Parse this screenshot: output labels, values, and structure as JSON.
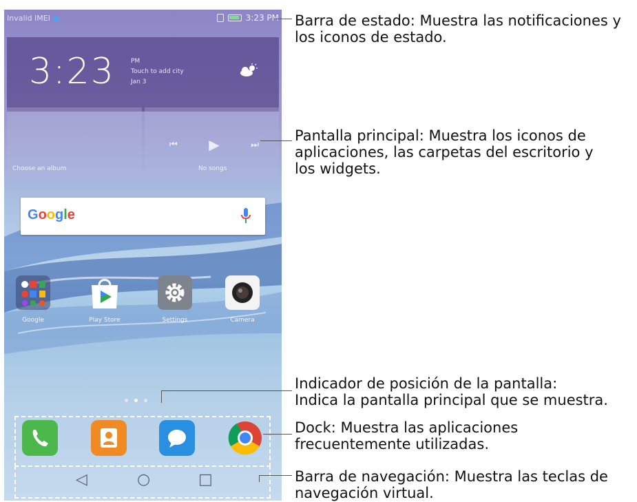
{
  "status_bar": {
    "left_text": "Invalid IMEI",
    "time": "3:23 PM"
  },
  "clock_widget": {
    "time": "3:23",
    "ampm": "PM",
    "city_prompt": "Touch to add city",
    "date": "Jan 3",
    "weather_icon": "partly-cloudy-icon"
  },
  "album_widget": {
    "caption": "Choose an album"
  },
  "music_widget": {
    "caption": "No songs"
  },
  "search_bar": {
    "logo_text": "Google",
    "logo_colors": [
      "#4285F4",
      "#EA4335",
      "#FBBC05",
      "#4285F4",
      "#34A853",
      "#EA4335"
    ]
  },
  "apps": [
    {
      "label": "Google",
      "icon": "google-folder-icon"
    },
    {
      "label": "Play Store",
      "icon": "play-store-icon"
    },
    {
      "label": "Settings",
      "icon": "settings-gear-icon"
    },
    {
      "label": "Camera",
      "icon": "camera-icon"
    }
  ],
  "page_indicator": {
    "count": 3,
    "active": 1
  },
  "dock": [
    {
      "icon": "phone-icon",
      "color": "#4cb84c"
    },
    {
      "icon": "contacts-icon",
      "color": "#f08a24"
    },
    {
      "icon": "messaging-icon",
      "color": "#2a8fe0"
    },
    {
      "icon": "chrome-icon",
      "color": "#ffffff"
    }
  ],
  "navigation": {
    "keys": [
      "back-icon",
      "home-icon",
      "recents-icon"
    ]
  },
  "annotations": [
    {
      "id": "status",
      "line1": "Barra de estado: Muestra las notificaciones y",
      "line2": "los iconos de estado.",
      "line3": ""
    },
    {
      "id": "home",
      "line1": "Pantalla principal: Muestra los iconos de",
      "line2": "aplicaciones, las carpetas del escritorio y",
      "line3": "los widgets."
    },
    {
      "id": "indicator",
      "line1": "Indicador de posición de la pantalla:",
      "line2": "Indica la pantalla principal que se muestra.",
      "line3": ""
    },
    {
      "id": "dock",
      "line1": "Dock: Muestra las aplicaciones",
      "line2": "frecuentemente utilizadas.",
      "line3": ""
    },
    {
      "id": "navbar",
      "line1": "Barra de navegación: Muestra las teclas de",
      "line2": "navegación virtual.",
      "line3": ""
    }
  ]
}
